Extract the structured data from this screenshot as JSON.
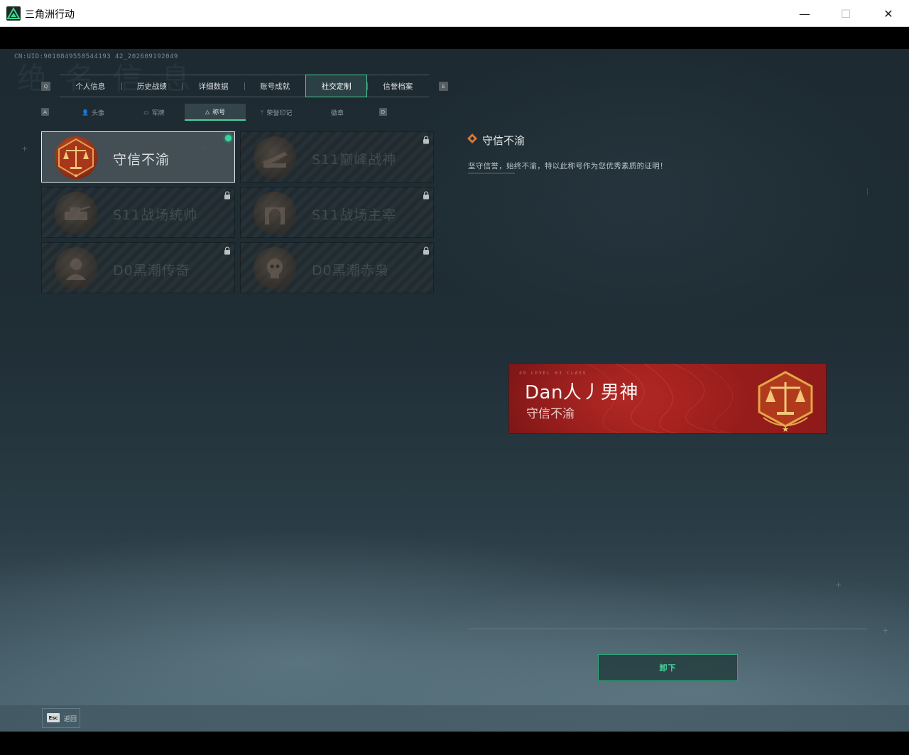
{
  "window": {
    "title": "三角洲行动",
    "minimize_glyph": "—",
    "maximize_glyph": "☐",
    "close_glyph": "✕"
  },
  "uid": "CN:UID:9010849550544193 42_202609192049",
  "main_tabs": {
    "prev_key": "Q",
    "next_key": "E",
    "items": [
      {
        "label": "个人信息"
      },
      {
        "label": "历史战绩"
      },
      {
        "label": "详细数据"
      },
      {
        "label": "账号成就"
      },
      {
        "label": "社交定制",
        "active": true
      },
      {
        "label": "信誉档案"
      }
    ]
  },
  "sub_tabs": {
    "prev_key": "A",
    "next_key": "D",
    "items": [
      {
        "label": "头像",
        "icon": "person-icon"
      },
      {
        "label": "军牌",
        "icon": "dogtag-icon"
      },
      {
        "label": "称号",
        "icon": "title-icon",
        "active": true
      },
      {
        "label": "荣誉印记",
        "icon": "honor-icon"
      },
      {
        "label": "徽章",
        "icon": ""
      }
    ]
  },
  "titles": [
    {
      "name": "守信不渝",
      "selected": true,
      "equipped": true,
      "locked": false,
      "medal": "scales-medal"
    },
    {
      "name": "S11巅峰战神",
      "selected": false,
      "locked": true,
      "medal": "aircraft-medal"
    },
    {
      "name": "S11战场统帅",
      "selected": false,
      "locked": true,
      "medal": "tank-medal"
    },
    {
      "name": "S11战场主宰",
      "selected": false,
      "locked": true,
      "medal": "arch-medal"
    },
    {
      "name": "D0黑潮传奇",
      "selected": false,
      "locked": true,
      "medal": "operator-medal"
    },
    {
      "name": "D0黑潮赤枭",
      "selected": false,
      "locked": true,
      "medal": "skull-medal"
    }
  ],
  "detail": {
    "title": "守信不渝",
    "description": "坚守信誉，始终不渝，特以此称号作为您优秀素质的证明！"
  },
  "banner": {
    "player_name": "Dan人丿男神",
    "title": "守信不渝",
    "meta": "49 LEVEL  63 CLASS",
    "background_color": "#9e1f1d"
  },
  "action": {
    "label": "卸下"
  },
  "footer": {
    "esc_key": "Esc",
    "back_label": "返回"
  },
  "colors": {
    "accent": "#4bcf9d",
    "equipped_dot": "#35d59b"
  }
}
